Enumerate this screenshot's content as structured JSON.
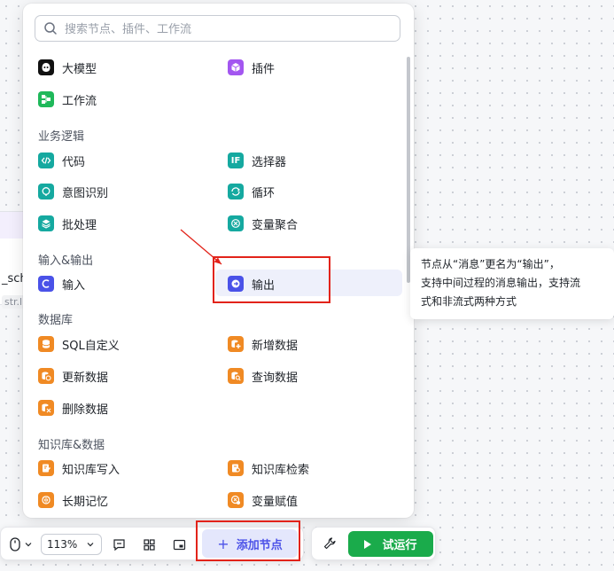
{
  "canvas_node": {
    "title": "_sch",
    "type_tag": "str.l"
  },
  "search": {
    "placeholder": "搜索节点、插件、工作流"
  },
  "top_items": {
    "llm": "大模型",
    "plugin": "插件",
    "workflow": "工作流"
  },
  "sections": {
    "business": "业务逻辑",
    "io": "输入&输出",
    "database": "数据库",
    "knowledge": "知识库&数据"
  },
  "business_items": {
    "code": "代码",
    "selector": "选择器",
    "intent": "意图识别",
    "loop": "循环",
    "batch": "批处理",
    "var_agg": "变量聚合"
  },
  "io_items": {
    "input": "输入",
    "output": "输出"
  },
  "db_items": {
    "sql": "SQL自定义",
    "insert": "新增数据",
    "update": "更新数据",
    "query": "查询数据",
    "delete": "删除数据"
  },
  "kb_items": {
    "kb_write": "知识库写入",
    "kb_search": "知识库检索",
    "memory": "长期记忆",
    "var_assign": "变量赋值"
  },
  "icon_glyphs": {
    "selector": "IF"
  },
  "tooltip": {
    "line1": "节点从“消息”更名为“输出”，",
    "line2": "支持中间过程的消息输出，支持流",
    "line3": "式和非流式两种方式"
  },
  "toolbar": {
    "zoom": "113%",
    "add_node": "添加节点",
    "plus": "+",
    "test_run": "试运行"
  },
  "colors": {
    "accent": "#4d53e8",
    "run_green": "#1aab4b",
    "annotation_red": "#e2231a"
  }
}
